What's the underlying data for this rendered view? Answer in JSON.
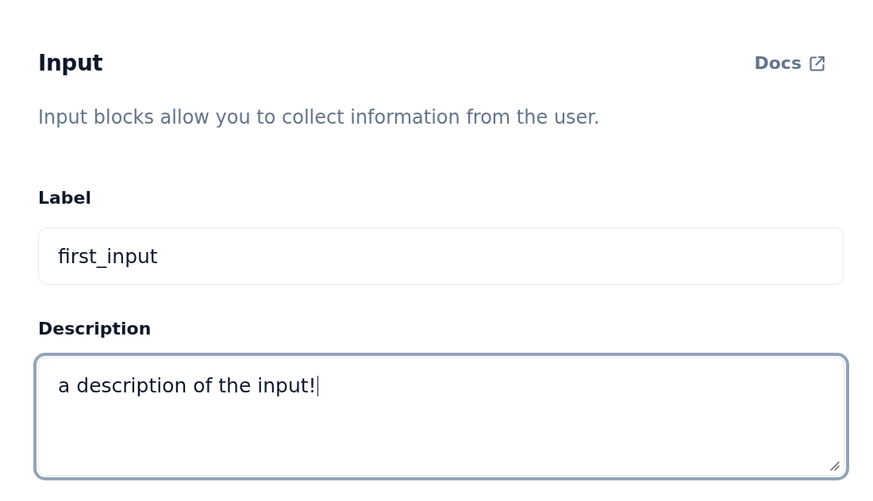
{
  "panel": {
    "title": "Input",
    "docs_link": {
      "label": "Docs"
    },
    "description": "Input blocks allow you to collect information from the user."
  },
  "fields": [
    {
      "kind": "input",
      "label": "Label",
      "value": "first_input",
      "focused": false
    },
    {
      "kind": "textarea",
      "label": "Description",
      "value": "a description of the input!",
      "focused": true
    }
  ]
}
